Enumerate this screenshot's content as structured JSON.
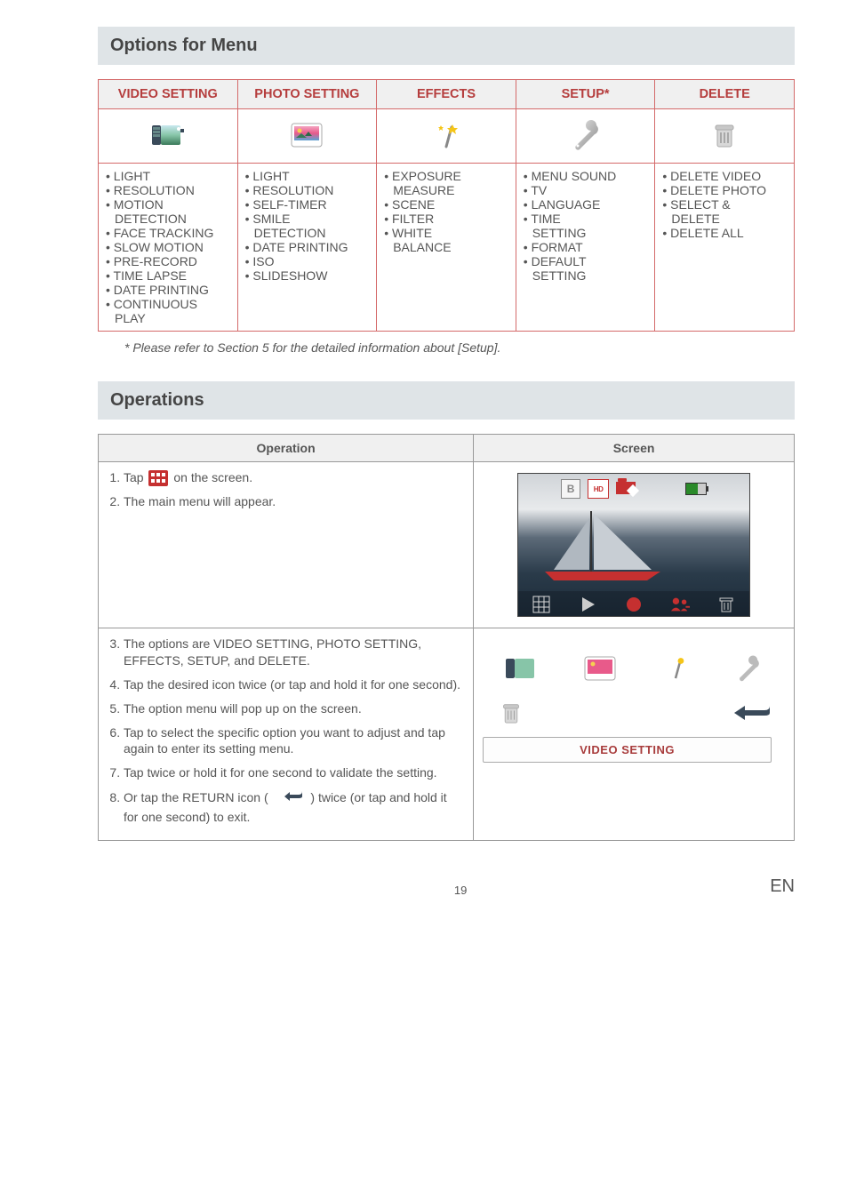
{
  "sections": {
    "options_title": "Options for Menu",
    "operations_title": "Operations"
  },
  "menu_table": {
    "headers": [
      "VIDEO SETTING",
      "PHOTO SETTING",
      "EFFECTS",
      "SETUP*",
      "DELETE"
    ],
    "cols": [
      [
        "LIGHT",
        "RESOLUTION",
        "MOTION",
        "DETECTION",
        "FACE TRACKING",
        "SLOW MOTION",
        "PRE-RECORD",
        "TIME LAPSE",
        "DATE PRINTING",
        "CONTINUOUS",
        "PLAY"
      ],
      [
        "LIGHT",
        "RESOLUTION",
        "SELF-TIMER",
        "SMILE",
        "DETECTION",
        "DATE PRINTING",
        "ISO",
        "SLIDESHOW"
      ],
      [
        "EXPOSURE",
        "MEASURE",
        "SCENE",
        "FILTER",
        "WHITE",
        "BALANCE"
      ],
      [
        "MENU SOUND",
        "TV",
        "LANGUAGE",
        "TIME",
        "SETTING",
        "FORMAT",
        "DEFAULT",
        "SETTING"
      ],
      [
        "DELETE VIDEO",
        "DELETE PHOTO",
        "SELECT &",
        "DELETE",
        "DELETE ALL"
      ]
    ]
  },
  "note": "* Please refer to Section 5 for the detailed information about [Setup].",
  "op_table": {
    "headers": [
      "Operation",
      "Screen"
    ],
    "steps_block1": {
      "1_pre": "Tap ",
      "1_post": " on the screen.",
      "2": "The main menu will appear."
    },
    "steps_block2": {
      "3": "The options are VIDEO SETTING, PHOTO SETTING, EFFECTS, SETUP, and DELETE.",
      "4": "Tap the desired icon twice (or tap and hold it for one second).",
      "5": "The option menu will pop up on the screen.",
      "6": "Tap to select the specific option you want to adjust and tap again to enter its setting menu.",
      "7": "Tap twice or hold it for one second to validate the setting.",
      "8_pre": "Or tap the RETURN icon (",
      "8_post": ") twice (or tap and hold it for one second) to exit."
    },
    "video_setting_label": "VIDEO SETTING"
  },
  "screen_icons": {
    "b": "B",
    "hd": "HD"
  },
  "footer": {
    "page": "19",
    "lang": "EN"
  }
}
